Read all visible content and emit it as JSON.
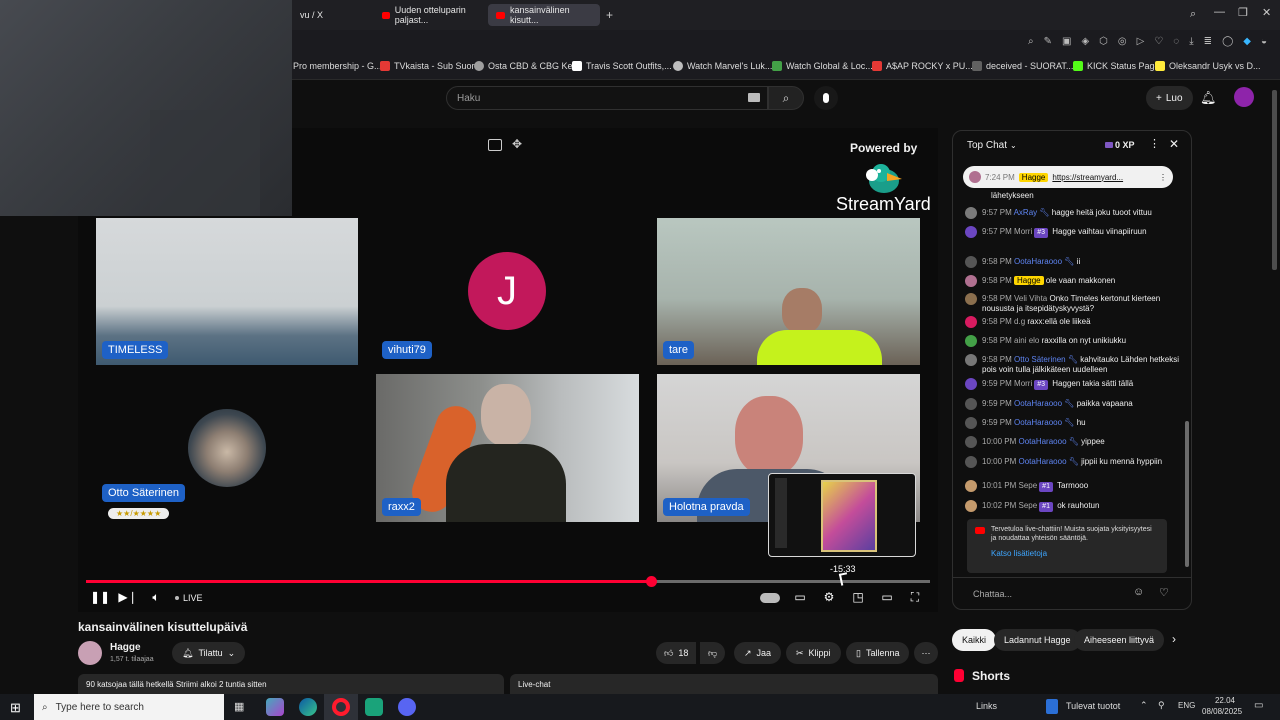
{
  "browser": {
    "tabs": [
      {
        "label": "vu / X",
        "active": false
      },
      {
        "label": "Uuden otteluparin paljast...",
        "active": false
      },
      {
        "label": "kansainvälinen kisutt...",
        "active": true
      }
    ],
    "bookmarks": [
      {
        "label": "Pro membership - G...",
        "color": "#4285f4"
      },
      {
        "label": "TVkaista - Sub Suora",
        "color": "#e53935"
      },
      {
        "label": "Osta CBD & CBG Ke...",
        "color": "#9e9e9e"
      },
      {
        "label": "Travis Scott Outfits,...",
        "color": "#ffffff"
      },
      {
        "label": "Watch Marvel's Luk...",
        "color": "#bdbdbd"
      },
      {
        "label": "Watch Global & Loc...",
        "color": "#43a047"
      },
      {
        "label": "A$AP ROCKY x PU...",
        "color": "#e53935"
      },
      {
        "label": "deceived - SUORAT...",
        "color": "#616161"
      },
      {
        "label": "KICK Status Page",
        "color": "#53fc18"
      },
      {
        "label": "Oleksandr Usyk vs D...",
        "color": "#ffeb3b"
      }
    ]
  },
  "header": {
    "search_placeholder": "Haku",
    "create_label": "Luo"
  },
  "video": {
    "powered_by": "Powered by",
    "brand": "StreamYard",
    "participants": [
      {
        "name": "TIMELESS"
      },
      {
        "name": "vihuti79",
        "initial": "J"
      },
      {
        "name": "tare"
      },
      {
        "name": "Otto Säterinen",
        "rating": "★★/★★★★"
      },
      {
        "name": "raxx2"
      },
      {
        "name": "Holotna pravda"
      }
    ],
    "progress_fraction": 0.67,
    "hover_time": "-15:33",
    "live_label": "LIVE"
  },
  "chat": {
    "title": "Top Chat",
    "xp_label": "0 XP",
    "pinned": {
      "time": "7:24 PM",
      "author": "Hagge",
      "link": "https://streamyard...",
      "extra": "lähetykseen"
    },
    "messages": [
      {
        "time": "9:57 PM",
        "author": "AxRay",
        "text": "hagge heitä joku tuoot vittuu",
        "mod": true,
        "color": "#7a7a7a"
      },
      {
        "time": "9:57 PM",
        "author": "Morri",
        "badge": "#3",
        "text": "Hagge vaihtau viinapiiruun",
        "color": "#6b46c1"
      },
      {
        "time": "9:58 PM",
        "author": "OotaHaraooo",
        "text": "ii",
        "mod": true,
        "color": "#555"
      },
      {
        "time": "9:58 PM",
        "author": "Hagge",
        "text": "ole vaan makkonen",
        "owner": true,
        "color": "#b07090"
      },
      {
        "time": "9:58 PM",
        "author": "Veli Vihta",
        "text": "Onko Timeles kertonut kierteen noususta ja itsepidätyskyvystä?",
        "color": "#8b6f4e"
      },
      {
        "time": "9:58 PM",
        "author": "d.g",
        "text": "raxx:ellä ole liikeä",
        "color": "#d81b60"
      },
      {
        "time": "9:58 PM",
        "author": "aini elo",
        "text": "raxxilla on nyt unikiukku",
        "color": "#43a047"
      },
      {
        "time": "9:58 PM",
        "author": "Otto Säterinen",
        "text": "kahvitauko Lähden hetkeksi pois voin tulla jälkikäteen uudelleen",
        "mod": true,
        "color": "#777"
      },
      {
        "time": "9:59 PM",
        "author": "Morri",
        "badge": "#3",
        "text": "Haggen takia sätti tällä",
        "color": "#6b46c1"
      },
      {
        "time": "9:59 PM",
        "author": "OotaHaraooo",
        "text": "paikka vapaana",
        "mod": true,
        "color": "#555"
      },
      {
        "time": "9:59 PM",
        "author": "OotaHaraooo",
        "text": "hu",
        "mod": true,
        "color": "#555"
      },
      {
        "time": "10:00 PM",
        "author": "OotaHaraooo",
        "text": "yippee",
        "mod": true,
        "color": "#555"
      },
      {
        "time": "10:00 PM",
        "author": "OotaHaraooo",
        "text": "jippii ku mennä hyppiin",
        "mod": true,
        "color": "#555"
      },
      {
        "time": "10:01 PM",
        "author": "Sepe",
        "badge": "#1",
        "text": "Tarmooo",
        "color": "#c49a6c"
      },
      {
        "time": "10:02 PM",
        "author": "Sepe",
        "badge": "#1",
        "text": "ok rauhotun",
        "color": "#c49a6c"
      }
    ],
    "welcome_text": "Tervetuloa live-chattiin! Muista suojata yksityisyytesi ja noudattaa yhteisön sääntöjä.",
    "welcome_link": "Katso lisätietoja",
    "input_placeholder": "Chattaa..."
  },
  "below": {
    "title": "kansainvälinen kisuttelupäivä",
    "channel": "Hagge",
    "subs": "1,57 t. tilaajaa",
    "subscribe_label": "Tilattu",
    "likes": "18",
    "share_label": "Jaa",
    "clip_label": "Klippi",
    "save_label": "Tallenna",
    "watching": "90 katsojaa tällä hetkellä Striimi alkoi 2 tuntia sitten",
    "livechat_label": "Live-chat",
    "chips": [
      "Kaikki",
      "Ladannut Hagge",
      "Aiheeseen liittyvä"
    ],
    "shorts_label": "Shorts"
  },
  "taskbar": {
    "search_placeholder": "Type here to search",
    "links_label": "Links",
    "tulevat_label": "Tulevat tuotot",
    "lang": "ENG",
    "time": "22.04",
    "date": "08/08/2025"
  }
}
